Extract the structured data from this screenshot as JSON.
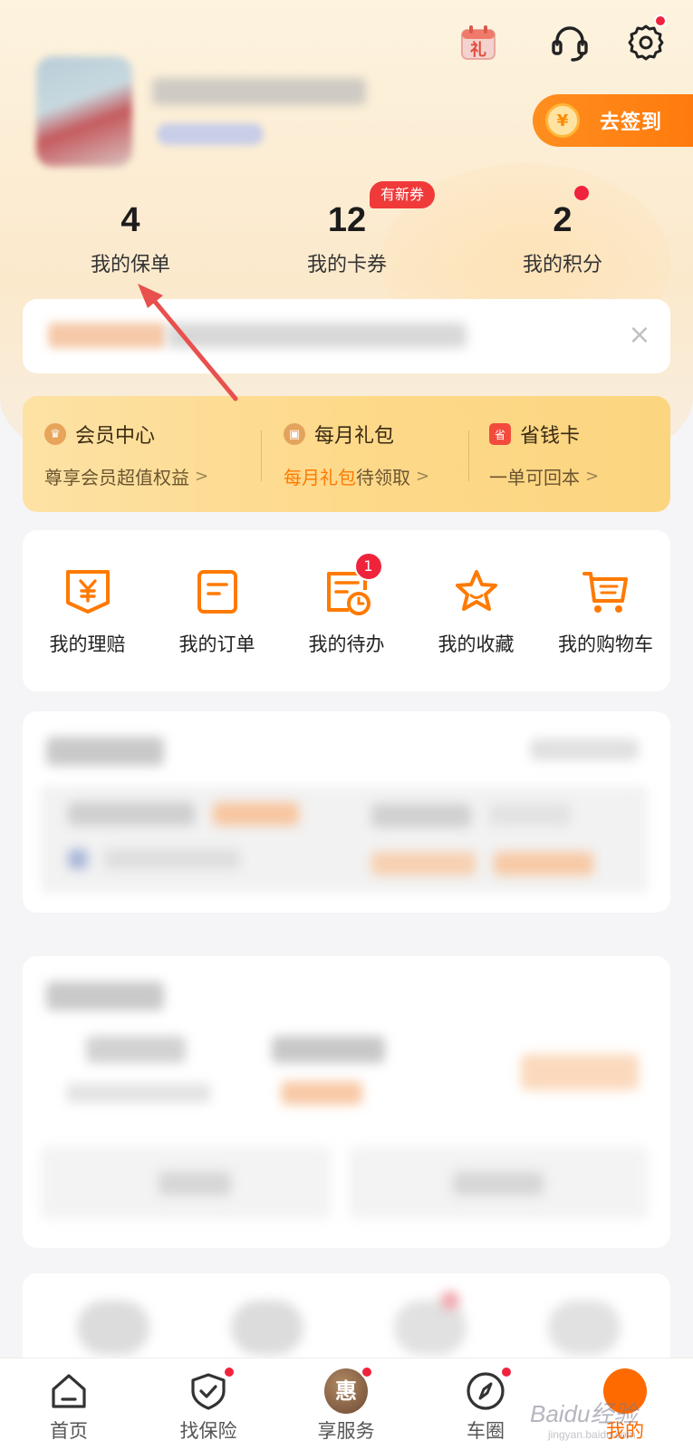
{
  "header": {
    "signin_label": "去签到",
    "signin_coin_symbol": "¥",
    "gift_calendar_char": "礼"
  },
  "stats": [
    {
      "value": "4",
      "label": "我的保单"
    },
    {
      "value": "12",
      "label": "我的卡券",
      "badge": "有新券"
    },
    {
      "value": "2",
      "label": "我的积分"
    }
  ],
  "notice": {
    "close_symbol": "×"
  },
  "member_banner": {
    "items": [
      {
        "title": "会员中心",
        "sub": "尊享会员超值权益",
        "sub_highlight": ""
      },
      {
        "title": "每月礼包",
        "sub": "待领取",
        "sub_highlight": "每月礼包"
      },
      {
        "title": "省钱卡",
        "sub": "一单可回本",
        "sub_highlight": ""
      }
    ],
    "save_card_icon_char": "省",
    "chevron": ">"
  },
  "quick_menu": {
    "items": [
      {
        "label": "我的理赔",
        "icon": "claim-icon"
      },
      {
        "label": "我的订单",
        "icon": "order-icon"
      },
      {
        "label": "我的待办",
        "icon": "todo-icon",
        "badge": "1"
      },
      {
        "label": "我的收藏",
        "icon": "star-icon"
      },
      {
        "label": "我的购物车",
        "icon": "cart-icon"
      }
    ]
  },
  "bottom_nav": {
    "items": [
      {
        "label": "首页",
        "icon": "home-icon"
      },
      {
        "label": "找保险",
        "icon": "shield-check-icon"
      },
      {
        "label": "享服务",
        "icon": "hui-icon",
        "icon_char": "惠"
      },
      {
        "label": "车圈",
        "icon": "compass-icon"
      },
      {
        "label": "我的",
        "icon": "mine-icon"
      }
    ],
    "active": "我的"
  },
  "watermark": {
    "text": "Baidu经验",
    "sub": "jingyan.baidu.com"
  },
  "colors": {
    "accent": "#ff7a00",
    "badge_red": "#f0233c",
    "banner_gold": "#fdd98a"
  }
}
